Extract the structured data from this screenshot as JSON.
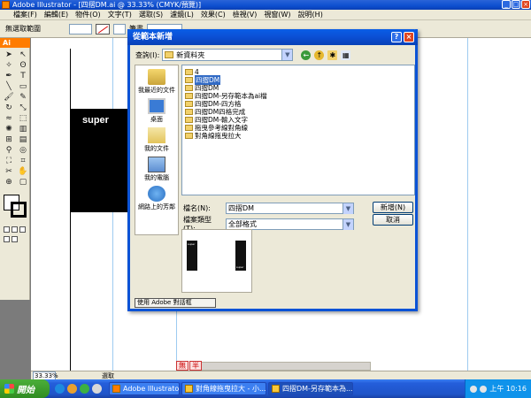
{
  "window": {
    "title": "Adobe Illustrator - [四摺DM.ai @ 33.33% (CMYK/預覽)]"
  },
  "menu": [
    "檔案(F)",
    "編輯(E)",
    "物件(O)",
    "文字(T)",
    "選取(S)",
    "濾鏡(L)",
    "效果(C)",
    "檢視(V)",
    "視窗(W)",
    "說明(H)"
  ],
  "controlbar": {
    "selection_label": "無選取範圍",
    "stroke_label": "筆畫"
  },
  "tools": {
    "logo": "Ai",
    "icons": [
      "selection-tool",
      "direct-selection-tool",
      "magic-wand-tool",
      "lasso-tool",
      "pen-tool",
      "type-tool",
      "line-tool",
      "rectangle-tool",
      "paintbrush-tool",
      "pencil-tool",
      "rotate-tool",
      "scale-tool",
      "warp-tool",
      "free-transform-tool",
      "symbol-sprayer-tool",
      "graph-tool",
      "mesh-tool",
      "gradient-tool",
      "eyedropper-tool",
      "blend-tool",
      "live-paint-tool",
      "slice-tool",
      "scissors-tool",
      "hand-tool",
      "zoom-tool",
      "artboard-tool"
    ]
  },
  "canvas": {
    "artwork_text": "super"
  },
  "statusbar": {
    "zoom": "33.33%",
    "tool": "選取",
    "tabs": [
      "無",
      "半"
    ]
  },
  "dialog": {
    "title": "從範本新增",
    "look_in_label": "查詢(I):",
    "look_in_value": "新資料夾",
    "places": [
      "我最近的文件",
      "桌面",
      "我的文件",
      "我的電腦",
      "網路上的芳鄰"
    ],
    "files": [
      "4",
      "四摺DM",
      "四摺DM",
      "四摺DM-另存範本為ai檔",
      "四摺DM-四方格",
      "四摺DM四格完成",
      "四摺DM-輸入文字",
      "拖曳參考線對角線",
      "對角線拖曳拉大"
    ],
    "selected_index": 1,
    "filename_label": "檔名(N):",
    "filename_value": "四摺DM",
    "filetype_label": "檔案類型(T):",
    "filetype_value": "全部格式",
    "new_button": "新增(N)",
    "cancel_button": "取消",
    "preview_text": "super",
    "adobe_dialog_button": "使用 Adobe 對話框"
  },
  "taskbar": {
    "start": "開始",
    "tasks": [
      {
        "label": "Adobe Illustrator - [四...",
        "active": false
      },
      {
        "label": "對角線拖曳拉大 - 小...",
        "active": false
      },
      {
        "label": "四摺DM-另存範本為...",
        "active": true
      }
    ],
    "time": "上午 10:16"
  },
  "colors": {
    "titlebar": "#0d4fd0",
    "ai_orange": "#ff7c00",
    "selection_blue": "#316ac5",
    "taskbar_blue": "#245edb",
    "start_green": "#2f8c21"
  }
}
